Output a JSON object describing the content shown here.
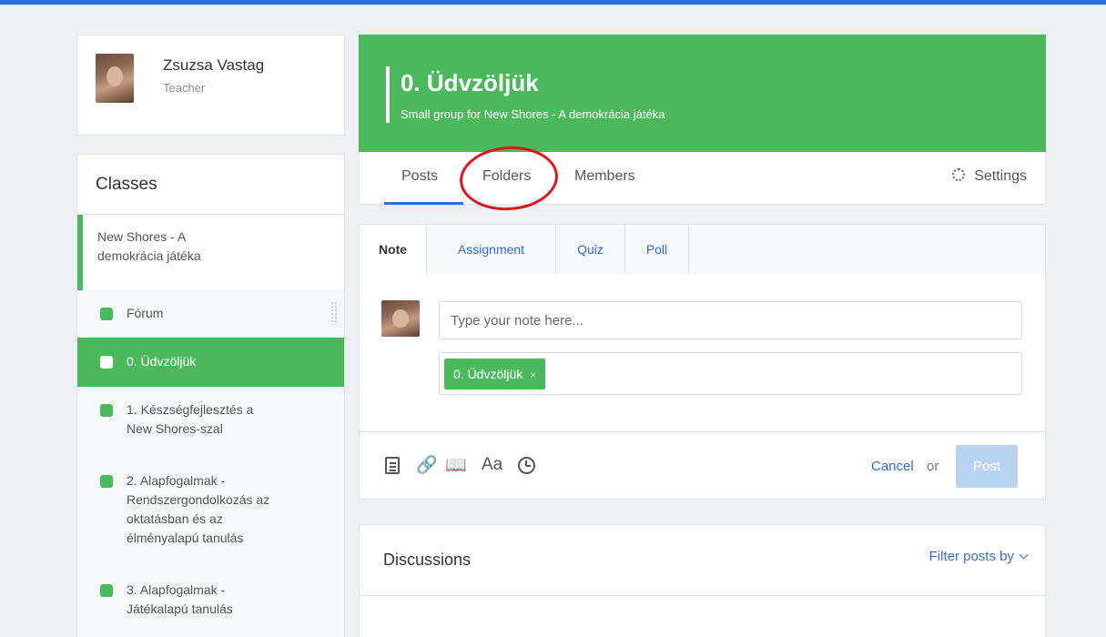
{
  "colors": {
    "accent": "#4cb85c",
    "link": "#2f6cd6",
    "annotation": "#e0141e"
  },
  "profile": {
    "name": "Zsuzsa Vastag",
    "role": "Teacher"
  },
  "classes": {
    "title": "Classes",
    "parent": "New Shores - A demokrácia játéka",
    "items": [
      {
        "label": "Fórum"
      },
      {
        "label": "0. Üdvzöljük",
        "active": true
      },
      {
        "label": "1. Készségfejlesztés a New Shores-szal"
      },
      {
        "label": "2. Alapfogalmak - Rendszergondolkozás az oktatásban és az élményalapú tanulás"
      },
      {
        "label": "3. Alapfogalmak - Játékalapú tanulás"
      }
    ]
  },
  "group": {
    "title": "0. Üdvzöljük",
    "subtitle": "Small group for New Shores - A demokrácia játéka"
  },
  "tabs": {
    "posts": "Posts",
    "folders": "Folders",
    "members": "Members",
    "settings": "Settings"
  },
  "composer": {
    "tabs": {
      "note": "Note",
      "assignment": "Assignment",
      "quiz": "Quiz",
      "poll": "Poll"
    },
    "note_placeholder": "Type your note here...",
    "recipient_chip": "0. Üdvzöljük",
    "chip_remove": "×",
    "tools": {
      "link": "🔗",
      "library": "📖",
      "format": "Aa"
    },
    "cancel": "Cancel",
    "or": "or",
    "post": "Post"
  },
  "discussions": {
    "title": "Discussions",
    "filter": "Filter posts by"
  }
}
